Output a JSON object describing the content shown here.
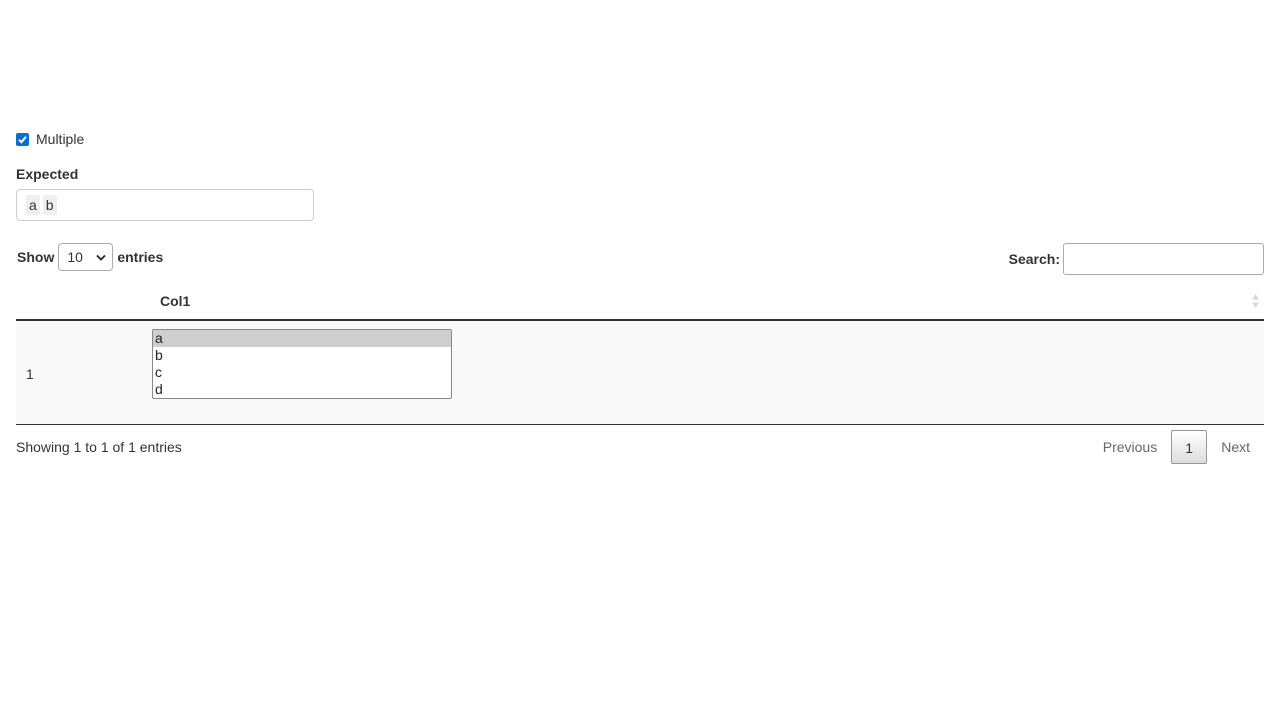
{
  "checkbox": {
    "label": "Multiple",
    "checked": true
  },
  "expected": {
    "label": "Expected",
    "tags": [
      "a",
      "b"
    ]
  },
  "length_menu": {
    "show_label": "Show",
    "value": "10",
    "entries_label": "entries"
  },
  "search": {
    "label": "Search:",
    "value": ""
  },
  "table": {
    "columns": [
      "",
      "Col1"
    ],
    "rows": [
      {
        "index": "1",
        "options": [
          "a",
          "b",
          "c",
          "d"
        ],
        "selected": "a"
      }
    ]
  },
  "info": "Showing 1 to 1 of 1 entries",
  "pagination": {
    "previous": "Previous",
    "current": "1",
    "next": "Next"
  }
}
